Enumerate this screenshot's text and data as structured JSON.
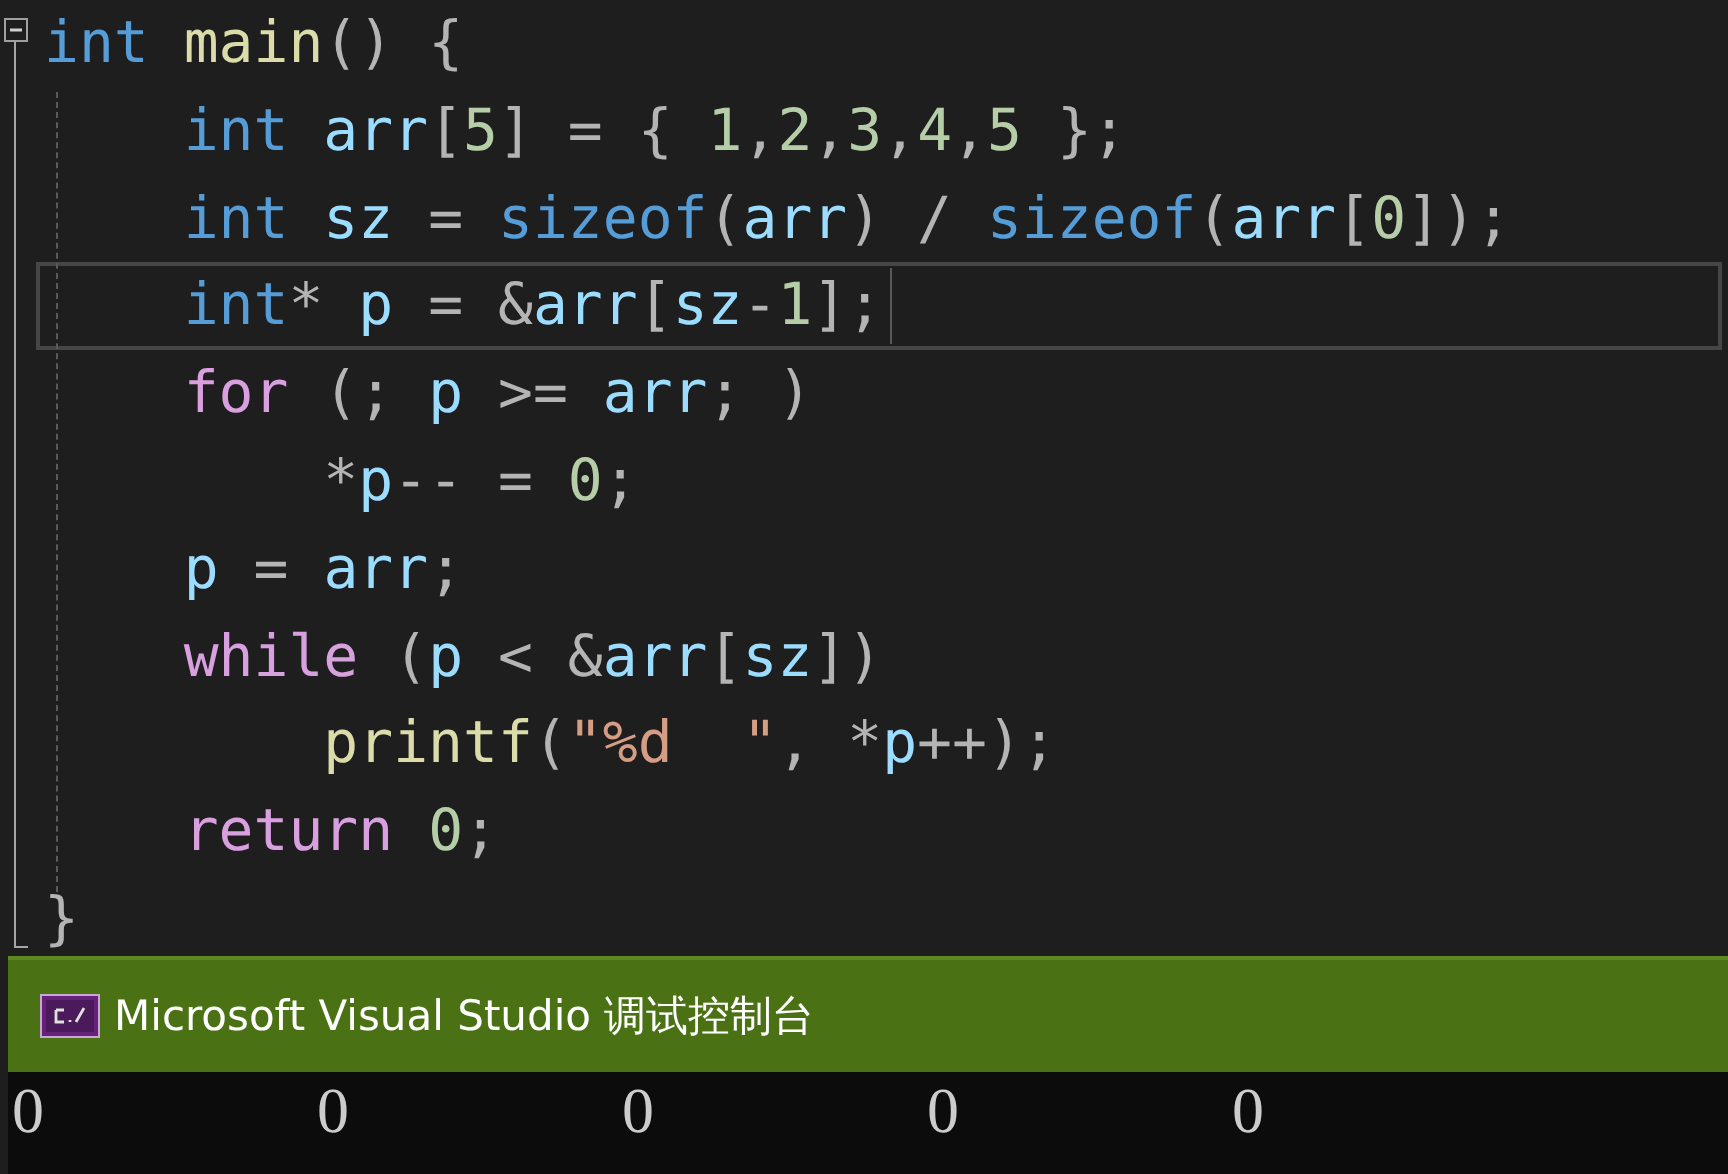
{
  "editor": {
    "lines": [
      {
        "current": false,
        "tokens": [
          {
            "kind": "kw",
            "text": "int"
          },
          {
            "kind": "fn",
            "text": " main"
          },
          {
            "kind": "p",
            "text": "() {"
          }
        ]
      },
      {
        "current": false,
        "tokens": [
          {
            "kind": "kw",
            "text": "    int"
          },
          {
            "kind": "var",
            "text": " arr"
          },
          {
            "kind": "p",
            "text": "["
          },
          {
            "kind": "num",
            "text": "5"
          },
          {
            "kind": "p",
            "text": "] = { "
          },
          {
            "kind": "num",
            "text": "1"
          },
          {
            "kind": "p",
            "text": ","
          },
          {
            "kind": "num",
            "text": "2"
          },
          {
            "kind": "p",
            "text": ","
          },
          {
            "kind": "num",
            "text": "3"
          },
          {
            "kind": "p",
            "text": ","
          },
          {
            "kind": "num",
            "text": "4"
          },
          {
            "kind": "p",
            "text": ","
          },
          {
            "kind": "num",
            "text": "5"
          },
          {
            "kind": "p",
            "text": " };"
          }
        ]
      },
      {
        "current": false,
        "tokens": [
          {
            "kind": "kw",
            "text": "    int"
          },
          {
            "kind": "var",
            "text": " sz"
          },
          {
            "kind": "p",
            "text": " = "
          },
          {
            "kind": "kw",
            "text": "sizeof"
          },
          {
            "kind": "p",
            "text": "("
          },
          {
            "kind": "var",
            "text": "arr"
          },
          {
            "kind": "p",
            "text": ") / "
          },
          {
            "kind": "kw",
            "text": "sizeof"
          },
          {
            "kind": "p",
            "text": "("
          },
          {
            "kind": "var",
            "text": "arr"
          },
          {
            "kind": "p",
            "text": "["
          },
          {
            "kind": "num",
            "text": "0"
          },
          {
            "kind": "p",
            "text": "]);"
          }
        ]
      },
      {
        "current": true,
        "tokens": [
          {
            "kind": "kw",
            "text": "    int"
          },
          {
            "kind": "p",
            "text": "* "
          },
          {
            "kind": "var",
            "text": "p"
          },
          {
            "kind": "p",
            "text": " = &"
          },
          {
            "kind": "var",
            "text": "arr"
          },
          {
            "kind": "p",
            "text": "["
          },
          {
            "kind": "var",
            "text": "sz"
          },
          {
            "kind": "p",
            "text": "-"
          },
          {
            "kind": "num",
            "text": "1"
          },
          {
            "kind": "p",
            "text": "];"
          }
        ]
      },
      {
        "current": false,
        "tokens": [
          {
            "kind": "ctl",
            "text": "    for"
          },
          {
            "kind": "p",
            "text": " (; "
          },
          {
            "kind": "var",
            "text": "p"
          },
          {
            "kind": "p",
            "text": " >= "
          },
          {
            "kind": "var",
            "text": "arr"
          },
          {
            "kind": "p",
            "text": "; )"
          }
        ]
      },
      {
        "current": false,
        "tokens": [
          {
            "kind": "p",
            "text": "        *"
          },
          {
            "kind": "var",
            "text": "p"
          },
          {
            "kind": "p",
            "text": "-- = "
          },
          {
            "kind": "num",
            "text": "0"
          },
          {
            "kind": "p",
            "text": ";"
          }
        ]
      },
      {
        "current": false,
        "tokens": [
          {
            "kind": "var",
            "text": "    p"
          },
          {
            "kind": "p",
            "text": " = "
          },
          {
            "kind": "var",
            "text": "arr"
          },
          {
            "kind": "p",
            "text": ";"
          }
        ]
      },
      {
        "current": false,
        "tokens": [
          {
            "kind": "ctl",
            "text": "    while"
          },
          {
            "kind": "p",
            "text": " ("
          },
          {
            "kind": "var",
            "text": "p"
          },
          {
            "kind": "p",
            "text": " < &"
          },
          {
            "kind": "var",
            "text": "arr"
          },
          {
            "kind": "p",
            "text": "["
          },
          {
            "kind": "var",
            "text": "sz"
          },
          {
            "kind": "p",
            "text": "])"
          }
        ]
      },
      {
        "current": false,
        "tokens": [
          {
            "kind": "fn",
            "text": "        printf"
          },
          {
            "kind": "p",
            "text": "("
          },
          {
            "kind": "str",
            "text": "\"%d  \""
          },
          {
            "kind": "p",
            "text": ", *"
          },
          {
            "kind": "var",
            "text": "p"
          },
          {
            "kind": "p",
            "text": "++);"
          }
        ]
      },
      {
        "current": false,
        "tokens": [
          {
            "kind": "ctl",
            "text": "    return"
          },
          {
            "kind": "num",
            "text": " 0"
          },
          {
            "kind": "p",
            "text": ";"
          }
        ]
      },
      {
        "current": false,
        "tokens": [
          {
            "kind": "p",
            "text": "}"
          }
        ]
      }
    ]
  },
  "console": {
    "title": "Microsoft Visual Studio 调试控制台",
    "output": [
      "0",
      "0",
      "0",
      "0",
      "0"
    ]
  }
}
